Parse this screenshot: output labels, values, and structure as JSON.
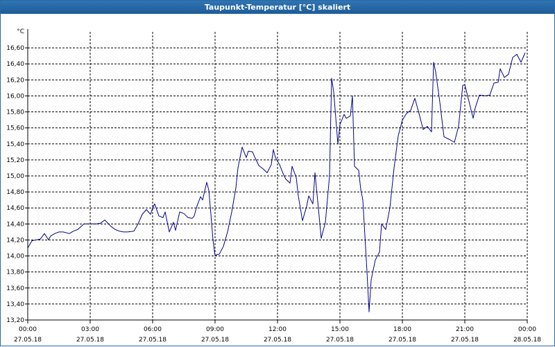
{
  "window": {
    "title": "Taupunkt-Temperatur [°C] skaliert"
  },
  "chart_data": {
    "type": "line",
    "title": "Taupunkt-Temperatur [°C] skaliert",
    "ylabel": "°C",
    "xlabel": "",
    "ylim": [
      13.2,
      16.8
    ],
    "xlim_hours": [
      0,
      24
    ],
    "y_ticks": [
      "13,20",
      "13,40",
      "13,60",
      "13,80",
      "14,00",
      "14,20",
      "14,40",
      "14,60",
      "14,80",
      "15,00",
      "15,20",
      "15,40",
      "15,60",
      "15,80",
      "16,00",
      "16,20",
      "16,40",
      "16,60"
    ],
    "x_ticks": [
      {
        "time": "00:00",
        "date": "27.05.18"
      },
      {
        "time": "03:00",
        "date": "27.05.18"
      },
      {
        "time": "06:00",
        "date": "27.05.18"
      },
      {
        "time": "09:00",
        "date": "27.05.18"
      },
      {
        "time": "12:00",
        "date": "27.05.18"
      },
      {
        "time": "15:00",
        "date": "27.05.18"
      },
      {
        "time": "18:00",
        "date": "27.05.18"
      },
      {
        "time": "21:00",
        "date": "27.05.18"
      },
      {
        "time": "00:00",
        "date": "28.05.18"
      }
    ],
    "grid": true,
    "line_color": "#00008b",
    "series": [
      {
        "x_hours": [
          0,
          0.2,
          0.4,
          0.6,
          0.8,
          1.0,
          1.1,
          1.3,
          1.5,
          1.7,
          2.0,
          2.2,
          2.4,
          2.7,
          2.9,
          3.1,
          3.3,
          3.5,
          3.7,
          4.0,
          4.2,
          4.4,
          4.6,
          4.8,
          5.1,
          5.3,
          5.5,
          5.7,
          5.9,
          6.0,
          6.1,
          6.3,
          6.5,
          6.6,
          6.8,
          7.0,
          7.1,
          7.3,
          7.5,
          7.7,
          7.9,
          8.0,
          8.1,
          8.3,
          8.4,
          8.6,
          8.7,
          8.8,
          8.9,
          9.0,
          9.1,
          9.2,
          9.4,
          9.6,
          9.8,
          10.0,
          10.1,
          10.3,
          10.5,
          10.6,
          10.8,
          10.9,
          11.1,
          11.3,
          11.5,
          11.7,
          11.8,
          11.9,
          12.1,
          12.3,
          12.4,
          12.6,
          12.7,
          12.9,
          13.0,
          13.2,
          13.4,
          13.5,
          13.7,
          13.8,
          14.0,
          14.1,
          14.3,
          14.5,
          14.6,
          14.7,
          14.9,
          15.0,
          15.2,
          15.3,
          15.5,
          15.6,
          15.7,
          15.9,
          16.0,
          16.1,
          16.3,
          16.4,
          16.5,
          16.7,
          16.9,
          17.0,
          17.2,
          17.4,
          17.6,
          17.8,
          18.0,
          18.2,
          18.4,
          18.6,
          18.8,
          19.0,
          19.2,
          19.4,
          19.5,
          19.6,
          19.8,
          20.0,
          20.3,
          20.5,
          20.7,
          20.9,
          21.0,
          21.2,
          21.4,
          21.5,
          21.7,
          22.0,
          22.2,
          22.4,
          22.6,
          22.7,
          22.9,
          23.1,
          23.3,
          23.5,
          23.7,
          23.9
        ],
        "values": [
          14.1,
          14.19,
          14.2,
          14.21,
          14.28,
          14.2,
          14.25,
          14.28,
          14.3,
          14.3,
          14.28,
          14.31,
          14.33,
          14.4,
          14.4,
          14.4,
          14.4,
          14.41,
          14.45,
          14.37,
          14.33,
          14.31,
          14.3,
          14.3,
          14.31,
          14.4,
          14.52,
          14.58,
          14.52,
          14.6,
          14.65,
          14.5,
          14.48,
          14.55,
          14.3,
          14.42,
          14.32,
          14.55,
          14.53,
          14.48,
          14.47,
          14.5,
          14.6,
          14.74,
          14.7,
          14.92,
          14.82,
          14.52,
          14.2,
          14.0,
          14.02,
          14.02,
          14.12,
          14.3,
          14.55,
          14.85,
          15.1,
          15.36,
          15.23,
          15.31,
          15.3,
          15.24,
          15.13,
          15.09,
          15.04,
          15.14,
          15.33,
          15.23,
          15.14,
          15.01,
          14.96,
          14.91,
          15.12,
          14.98,
          14.75,
          14.44,
          14.62,
          14.75,
          14.65,
          15.04,
          14.5,
          14.22,
          14.42,
          15.0,
          16.22,
          16.05,
          15.4,
          15.64,
          15.77,
          15.72,
          15.75,
          16.0,
          15.12,
          15.07,
          14.83,
          14.7,
          13.8,
          13.3,
          13.7,
          13.95,
          14.05,
          14.4,
          14.33,
          14.6,
          15.1,
          15.5,
          15.7,
          15.78,
          15.82,
          15.97,
          15.78,
          15.58,
          15.62,
          15.55,
          16.42,
          16.3,
          15.92,
          15.49,
          15.45,
          15.42,
          15.62,
          16.13,
          16.14,
          15.93,
          15.72,
          15.85,
          16.01,
          16.0,
          16.01,
          16.16,
          16.17,
          16.34,
          16.23,
          16.27,
          16.48,
          16.52,
          16.42,
          16.54,
          16.68
        ]
      }
    ]
  }
}
